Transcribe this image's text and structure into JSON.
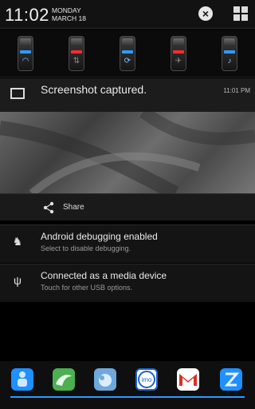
{
  "header": {
    "time": "11:02",
    "day": "MONDAY",
    "date": "MARCH 18",
    "clear_icon": "close-circle-icon",
    "settings_icon": "grid-icon"
  },
  "toggles": [
    {
      "name": "wifi-toggle",
      "indicator_color": "#2f9bff",
      "icon": "wifi-icon"
    },
    {
      "name": "data-toggle",
      "indicator_color": "#ff2b2b",
      "icon": "data-arrows-icon"
    },
    {
      "name": "rotate-toggle",
      "indicator_color": "#2f9bff",
      "icon": "rotate-icon"
    },
    {
      "name": "airplane-toggle",
      "indicator_color": "#ff2b2b",
      "icon": "airplane-icon"
    },
    {
      "name": "sound-toggle",
      "indicator_color": "#2f9bff",
      "icon": "sound-mute-icon"
    }
  ],
  "notifications": {
    "screenshot": {
      "title": "Screenshot captured.",
      "time": "11:01 PM",
      "share_label": "Share"
    },
    "debugging": {
      "title": "Android debugging enabled",
      "subtitle": "Select to disable debugging."
    },
    "usb": {
      "title": "Connected as a media device",
      "subtitle": "Touch for other USB options."
    }
  },
  "dock": {
    "apps": [
      {
        "icon": "app-blue-person-icon",
        "color": "#1e90ff"
      },
      {
        "icon": "dolphin-browser-icon",
        "color": "#4caf50"
      },
      {
        "icon": "app-cloud-icon",
        "color": "#6fa8dc"
      },
      {
        "icon": "imo-icon",
        "color": "#ffffff"
      },
      {
        "icon": "gmail-icon",
        "color": "#ffffff"
      },
      {
        "icon": "app-blue-z-icon",
        "color": "#1e90ff"
      }
    ]
  },
  "colors": {
    "accent_blue": "#2f9bff",
    "toggle_red": "#ff2b2b"
  }
}
